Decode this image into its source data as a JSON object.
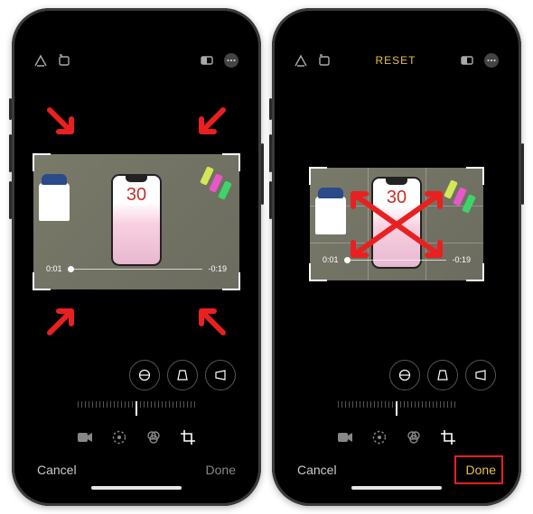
{
  "topbar": {
    "reset_label": "RESET"
  },
  "video": {
    "time_elapsed": "0:01",
    "time_remaining": "-0:19",
    "display_number": "30"
  },
  "actions": {
    "cancel_label": "Cancel",
    "done_label": "Done"
  },
  "annotation": {
    "arrows_left": [
      "pointing to top-left corner",
      "pointing to top-right corner",
      "pointing to bottom-left corner",
      "pointing to bottom-right corner"
    ],
    "arrows_right": "four-way drag arrows",
    "highlight_right": "Done button highlighted"
  }
}
